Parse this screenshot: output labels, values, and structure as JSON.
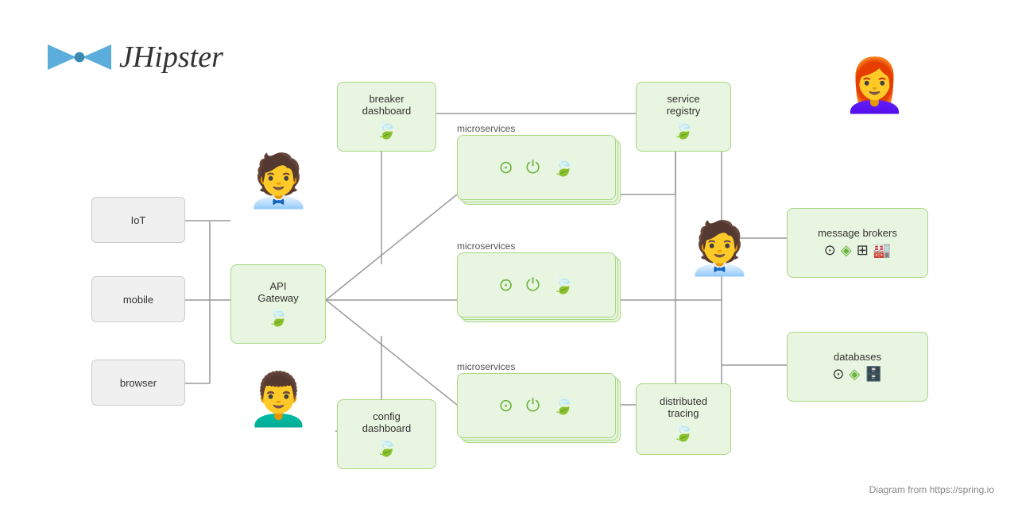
{
  "logo": {
    "title": "JHipster",
    "bowtie_color": "#5baddc"
  },
  "footer": "Diagram from https://spring.io",
  "boxes": {
    "iot": {
      "label": "IoT"
    },
    "mobile": {
      "label": "mobile"
    },
    "browser": {
      "label": "browser"
    },
    "api_gateway": {
      "label": "API\nGateway"
    },
    "breaker_dashboard": {
      "label": "breaker\ndashboard"
    },
    "service_registry": {
      "label": "service\nregistry"
    },
    "config_dashboard": {
      "label": "config\ndashboard"
    },
    "distributed_tracing": {
      "label": "distributed\ntracing"
    },
    "message_brokers": {
      "label": "message brokers"
    },
    "databases": {
      "label": "databases"
    }
  },
  "microservices_label": "microservices",
  "colors": {
    "green_bg": "#e8f5e0",
    "green_border": "#a8d880",
    "gray_bg": "#f0f0f0",
    "gray_border": "#cccccc",
    "spring_green": "#6db33f",
    "line_color": "#999999"
  }
}
